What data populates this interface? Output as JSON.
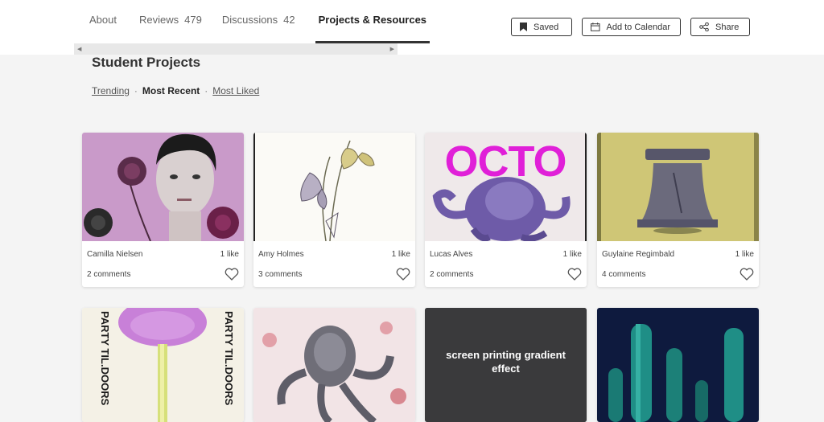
{
  "tabs": [
    {
      "label": "About"
    },
    {
      "label": "Reviews",
      "count": "479"
    },
    {
      "label": "Discussions",
      "count": "42"
    },
    {
      "label": "Projects & Resources"
    }
  ],
  "actions": {
    "saved": "Saved",
    "calendar": "Add to Calendar",
    "share": "Share"
  },
  "section": {
    "title": "Student Projects"
  },
  "filters": {
    "trending": "Trending",
    "recent": "Most Recent",
    "liked": "Most Liked"
  },
  "projects": [
    {
      "author": "Camilla Nielsen",
      "likes": "1 like",
      "comments": "2 comments"
    },
    {
      "author": "Amy Holmes",
      "likes": "1 like",
      "comments": "3 comments"
    },
    {
      "author": "Lucas Alves",
      "likes": "1 like",
      "comments": "2 comments",
      "thumb_text": "OCTO"
    },
    {
      "author": "Guylaine Regimbald",
      "likes": "1 like",
      "comments": "4 comments"
    },
    {
      "thumb_text": "PARTY TIL.DOORS"
    },
    {},
    {
      "thumb_text": "screen printing gradient effect"
    },
    {}
  ],
  "colors": {
    "accent_magenta": "#e020d8",
    "card_dark": "#3a3a3c",
    "navy": "#0e1a3e"
  }
}
